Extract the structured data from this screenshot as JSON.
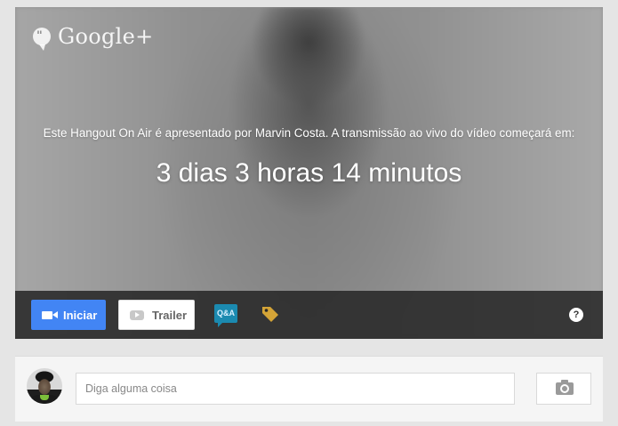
{
  "brand": {
    "logo_text": "Google+",
    "hangouts_glyph": "\"",
    "icon": "hangouts-icon"
  },
  "event": {
    "info_text": "Este Hangout On Air é apresentado por Marvin Costa. A transmissão ao vivo do vídeo começará em:",
    "countdown": "3 dias 3 horas 14 minutos"
  },
  "toolbar": {
    "start_label": "Iniciar",
    "start_icon": "video-camera-icon",
    "trailer_label": "Trailer",
    "trailer_icon": "youtube-play-icon",
    "qa_label": "Q&A",
    "tag_icon": "tag-icon",
    "help_label": "?"
  },
  "composer": {
    "placeholder": "Diga alguma coisa",
    "photo_icon": "camera-icon"
  },
  "colors": {
    "primary_button": "#4285f4",
    "qa_badge": "#1b8ab0",
    "tag": "#d4a437",
    "toolbar_bg": "#282828",
    "page_bg": "#e5e5e5"
  }
}
